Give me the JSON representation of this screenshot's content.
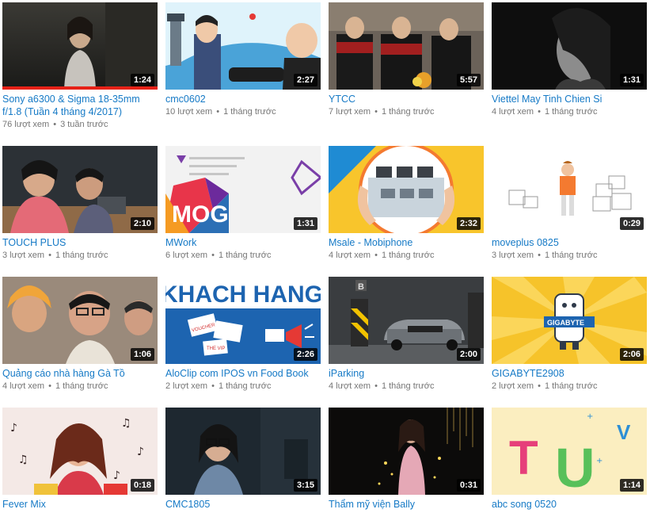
{
  "videos": [
    {
      "title": "Sony a6300 & Sigma 18-35mm f/1.8 (Tuần 4 tháng 4/2017)",
      "duration": "1:24",
      "views": "76 lượt xem",
      "age": "3 tuần trước",
      "watched": 1.0
    },
    {
      "title": "cmc0602",
      "duration": "2:27",
      "views": "10 lượt xem",
      "age": "1 tháng trước"
    },
    {
      "title": "YTCC",
      "duration": "5:57",
      "views": "7 lượt xem",
      "age": "1 tháng trước"
    },
    {
      "title": "Viettel May Tinh Chien Si",
      "duration": "1:31",
      "views": "4 lượt xem",
      "age": "1 tháng trước"
    },
    {
      "title": "TOUCH PLUS",
      "duration": "2:10",
      "views": "3 lượt xem",
      "age": "1 tháng trước"
    },
    {
      "title": "MWork",
      "duration": "1:31",
      "views": "6 lượt xem",
      "age": "1 tháng trước"
    },
    {
      "title": "Msale - Mobiphone",
      "duration": "2:32",
      "views": "4 lượt xem",
      "age": "1 tháng trước"
    },
    {
      "title": "moveplus 0825",
      "duration": "0:29",
      "views": "3 lượt xem",
      "age": "1 tháng trước"
    },
    {
      "title": "Quảng cáo nhà hàng Gà Tồ",
      "duration": "1:06",
      "views": "4 lượt xem",
      "age": "1 tháng trước"
    },
    {
      "title": "AloClip com IPOS vn Food Book",
      "duration": "2:26",
      "views": "2 lượt xem",
      "age": "1 tháng trước"
    },
    {
      "title": "iParking",
      "duration": "2:00",
      "views": "4 lượt xem",
      "age": "1 tháng trước"
    },
    {
      "title": "GIGABYTE2908",
      "duration": "2:06",
      "views": "2 lượt xem",
      "age": "1 tháng trước"
    },
    {
      "title": "Fever Mix",
      "duration": "0:18",
      "views": "",
      "age": ""
    },
    {
      "title": "CMC1805",
      "duration": "3:15",
      "views": "",
      "age": ""
    },
    {
      "title": "Thẩm mỹ viện Bally",
      "duration": "0:31",
      "views": "",
      "age": ""
    },
    {
      "title": "abc song 0520",
      "duration": "1:14",
      "views": "",
      "age": ""
    }
  ],
  "thumb_text": {
    "mog": "MOG",
    "khach_hang": "KHACH HANG",
    "gigabyte": "GIGABYTE",
    "tu": "TU",
    "v": "V",
    "vouchers": "VOUCHER",
    "the_vip": "THE VIP",
    "b": "B"
  }
}
